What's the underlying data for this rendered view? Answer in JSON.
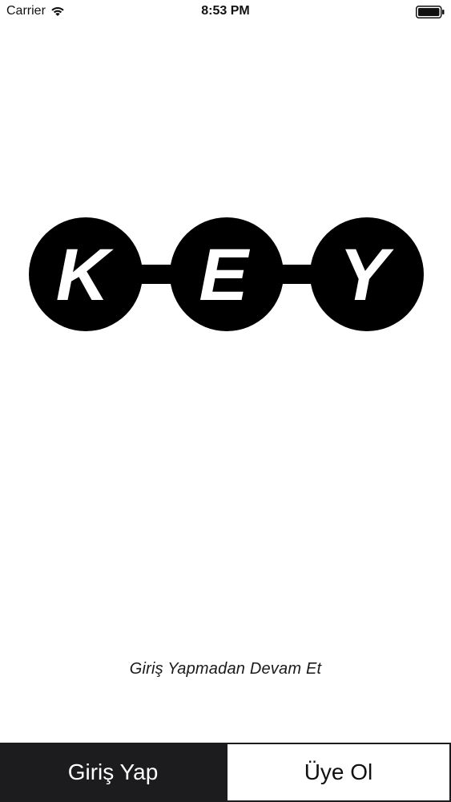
{
  "status_bar": {
    "carrier": "Carrier",
    "time": "8:53 PM",
    "wifi_icon": "wifi-icon",
    "battery_icon": "battery-icon"
  },
  "logo": {
    "letters": [
      "K",
      "E",
      "Y"
    ]
  },
  "continue_link": "Giriş Yapmadan Devam Et",
  "buttons": {
    "login_label": "Giriş Yap",
    "signup_label": "Üye Ol"
  },
  "colors": {
    "primary_dark": "#1c1c1e",
    "background": "#ffffff"
  }
}
